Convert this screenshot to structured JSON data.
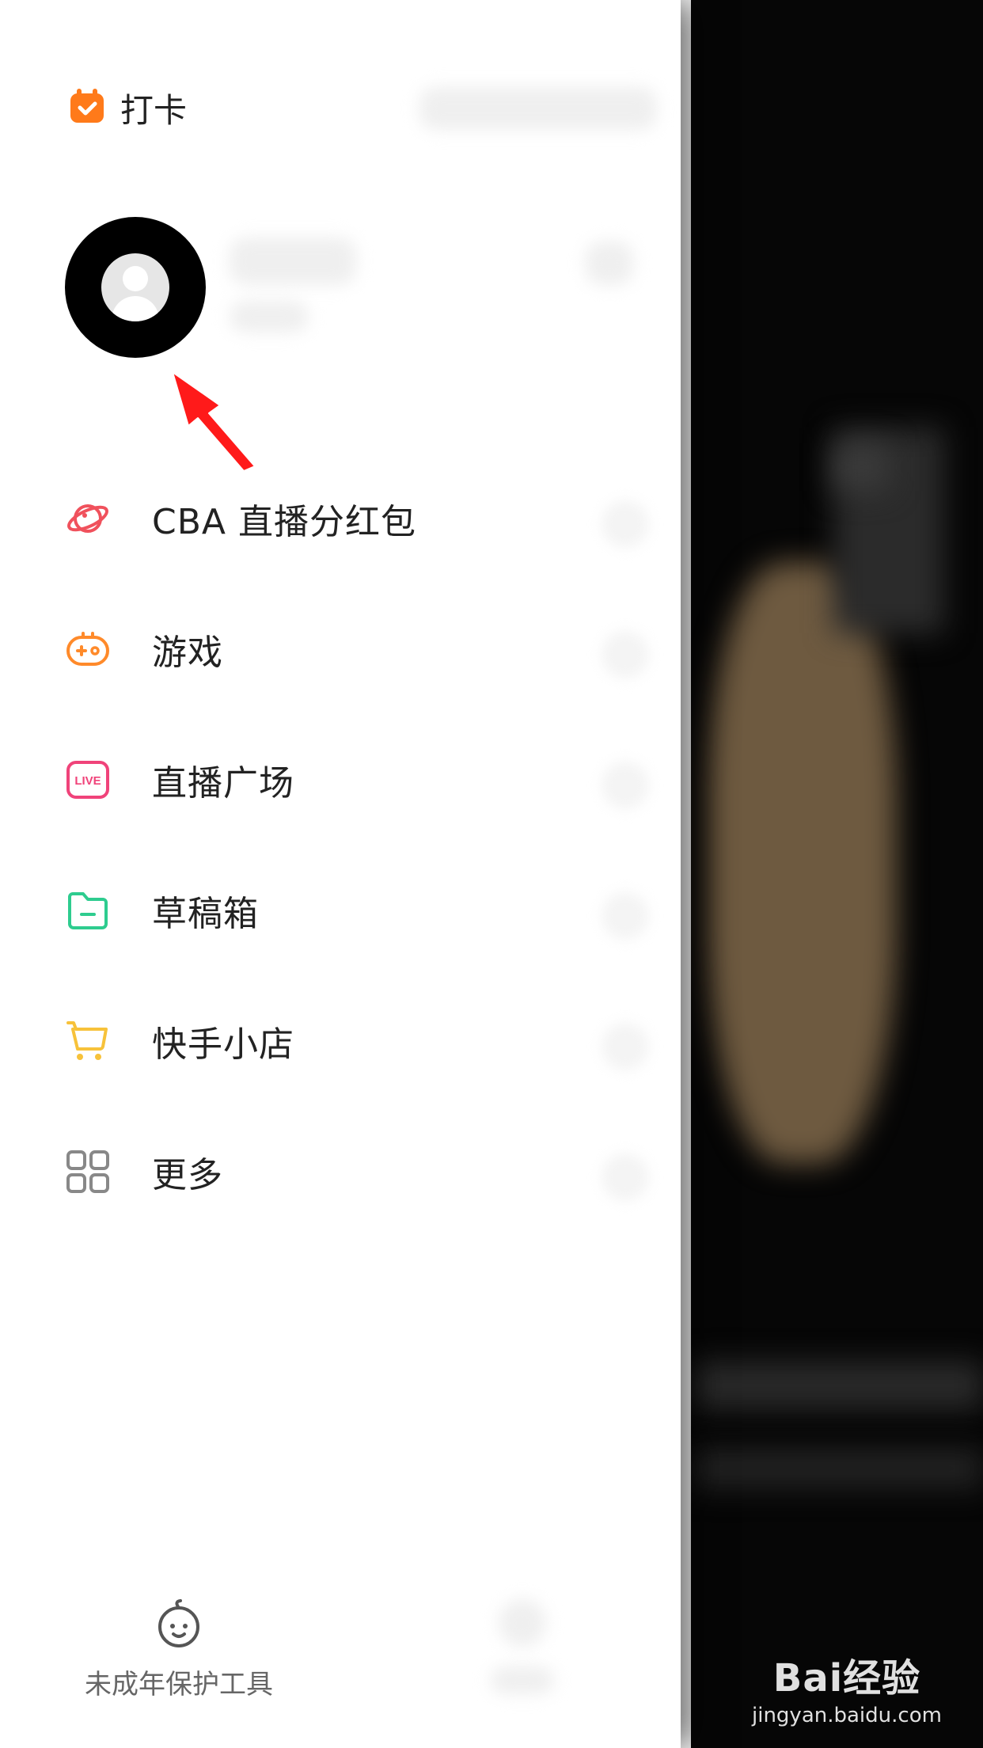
{
  "checkin": {
    "label": "打卡"
  },
  "menu": {
    "items": [
      {
        "label": "CBA 直播分红包",
        "icon": "planet-icon",
        "color": "#F0515C"
      },
      {
        "label": "游戏",
        "icon": "gamepad-icon",
        "color": "#FF8A2A"
      },
      {
        "label": "直播广场",
        "icon": "live-icon",
        "color": "#F0437A"
      },
      {
        "label": "草稿箱",
        "icon": "folder-icon",
        "color": "#2ECC8F"
      },
      {
        "label": "快手小店",
        "icon": "cart-icon",
        "color": "#F7C23A"
      },
      {
        "label": "更多",
        "icon": "grid-icon",
        "color": "#888888"
      }
    ]
  },
  "footer": {
    "minor_label": "未成年保护工具",
    "minor_icon": "baby-face-icon"
  },
  "watermark": {
    "brand": "Bai经验",
    "url": "jingyan.baidu.com"
  },
  "colors": {
    "accent_orange": "#FF7A1A",
    "arrow_red": "#FF1A1A"
  }
}
